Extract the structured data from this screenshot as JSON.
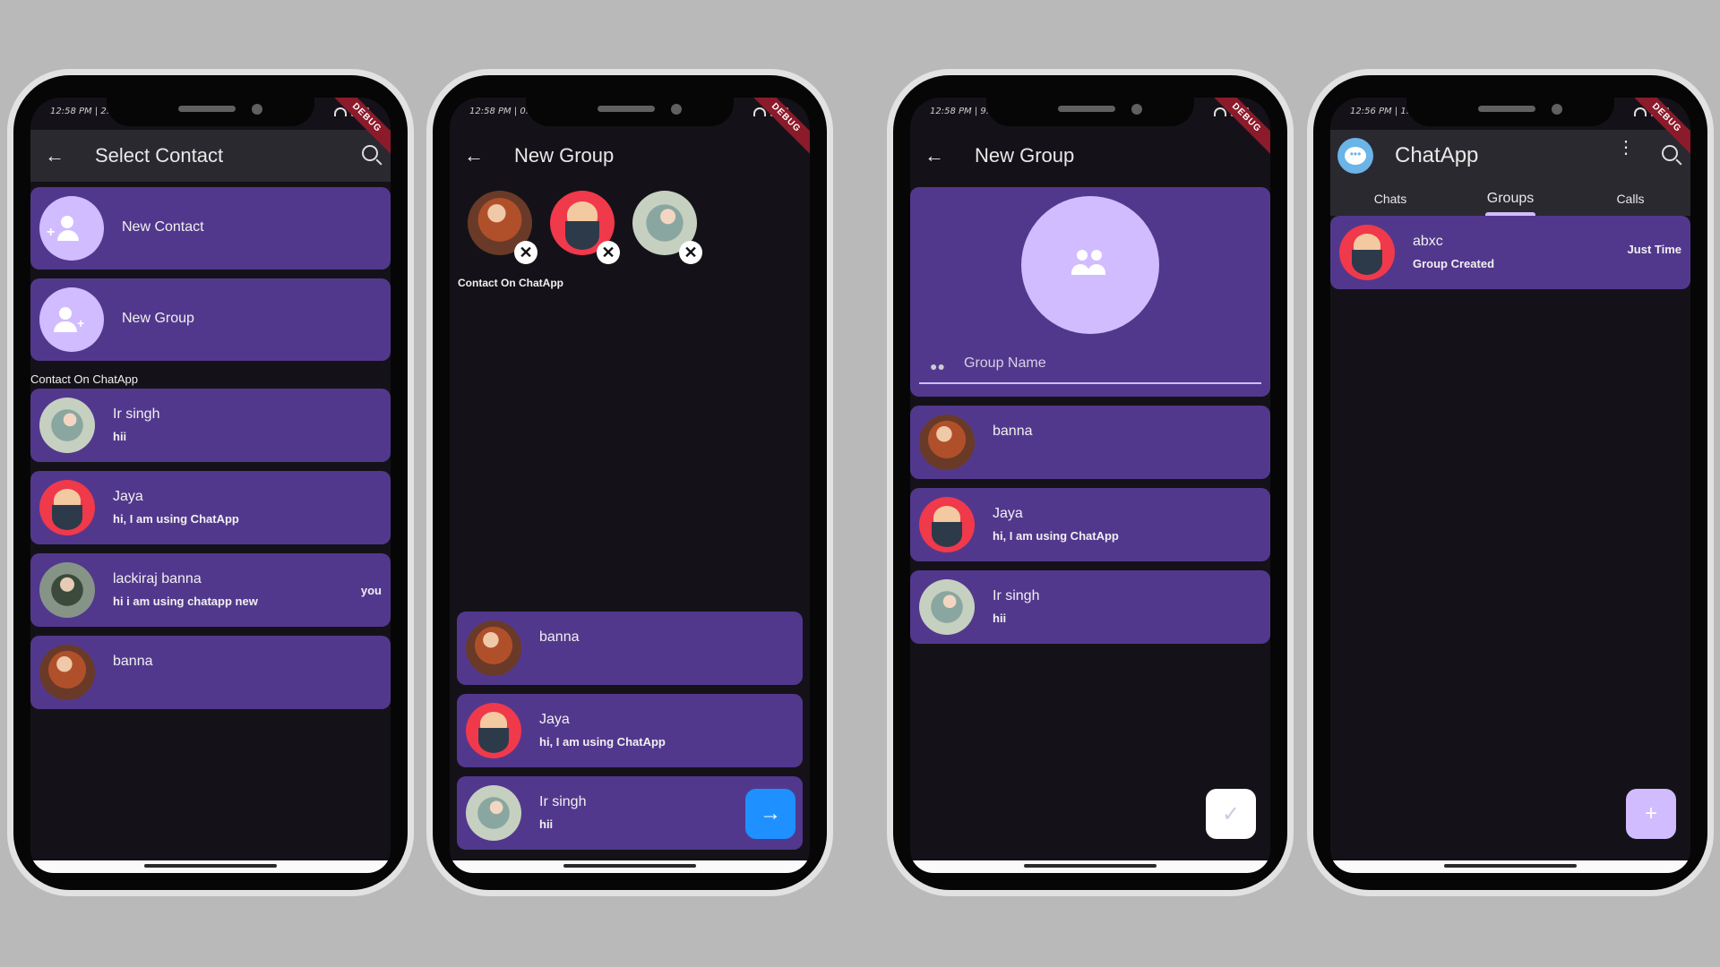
{
  "colors": {
    "card": "#52388d",
    "background": "#141218",
    "appbar": "#2b2930",
    "accent": "#d0bcff",
    "fab_blue": "#1e90ff"
  },
  "common": {
    "status_time": "12:58 PM",
    "debug": "DEBUG",
    "section_label": "Contact On ChatApp"
  },
  "phone1": {
    "status": "12:58 PM | 2.",
    "title": "Select Contact",
    "new_contact": "New Contact",
    "new_group": "New Group",
    "section": "Contact On ChatApp",
    "contacts": [
      {
        "name": "Ir singh",
        "status": "hii",
        "right": ""
      },
      {
        "name": "Jaya",
        "status": "hi, I am using ChatApp",
        "right": ""
      },
      {
        "name": "lackiraj banna",
        "status": "hi i am using chatapp  new",
        "right": "you"
      },
      {
        "name": "banna",
        "status": "",
        "right": ""
      }
    ]
  },
  "phone2": {
    "status": "12:58 PM | 0.",
    "title": "New Group",
    "selected_label": "Contact On ChatApp",
    "contacts": [
      {
        "name": "banna",
        "status": ""
      },
      {
        "name": "Jaya",
        "status": "hi, I am using ChatApp"
      },
      {
        "name": "Ir singh",
        "status": "hii"
      }
    ]
  },
  "phone3": {
    "status": "12:58 PM | 9.",
    "title": "New Group",
    "group_name_placeholder": "Group Name",
    "contacts": [
      {
        "name": "banna",
        "status": ""
      },
      {
        "name": "Jaya",
        "status": "hi, I am using ChatApp"
      },
      {
        "name": "Ir singh",
        "status": "hii"
      }
    ]
  },
  "phone4": {
    "status": "12:56 PM | 1.",
    "title": "ChatApp",
    "tabs": [
      "Chats",
      "Groups",
      "Calls"
    ],
    "group": {
      "name": "abxc",
      "status": "Group Created",
      "time": "Just Time"
    },
    "fab": "+"
  }
}
